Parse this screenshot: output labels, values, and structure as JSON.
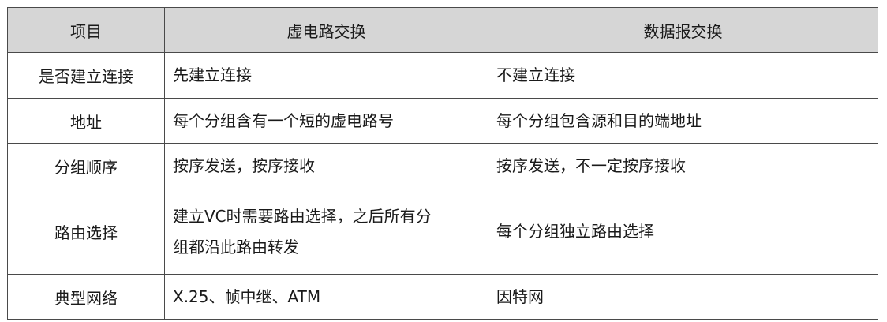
{
  "table": {
    "headers": [
      "项目",
      "虚电路交换",
      "数据报交换"
    ],
    "rows": [
      {
        "item": "是否建立连接",
        "vc": "先建立连接",
        "dg": "不建立连接"
      },
      {
        "item": "地址",
        "vc": "每个分组含有一个短的虚电路号",
        "dg": "每个分组包含源和目的端地址"
      },
      {
        "item": "分组顺序",
        "vc": "按序发送，按序接收",
        "dg": "按序发送，不一定按序接收"
      },
      {
        "item": "路由选择",
        "vc_line1": "建立VC时需要路由选择，之后所有分",
        "vc_line2": "组都沿此路由转发",
        "dg": "每个分组独立路由选择"
      },
      {
        "item": "典型网络",
        "vc": "X.25、帧中继、ATM",
        "dg": "因特网"
      }
    ]
  }
}
